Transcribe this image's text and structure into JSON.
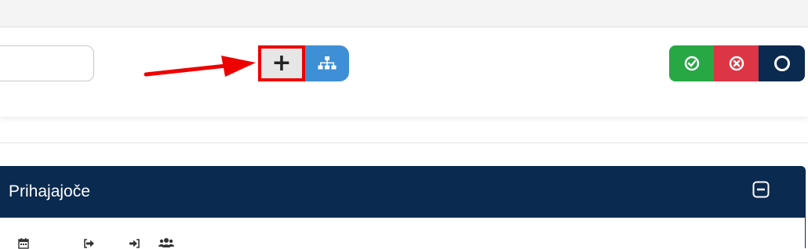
{
  "search": {
    "value": "",
    "placeholder": ""
  },
  "toolbar": {
    "add_button_icon": "plus-icon",
    "hierarchy_button_icon": "sitemap-icon",
    "highlight_color": "#ee0000",
    "annotation": "red-arrow-pointing-to-add-button"
  },
  "actions": {
    "confirm_icon": "check-circle-icon",
    "confirm_color": "#28a745",
    "reject_icon": "times-circle-icon",
    "reject_color": "#dc3545",
    "neutral_icon": "circle-outline-icon",
    "neutral_color": "#0b2a4f"
  },
  "panel": {
    "title": "Prihajajoče",
    "header_color": "#0b2a4f",
    "collapse_icon": "minus-square-icon",
    "columns": [
      {
        "icon": "calendar-icon"
      },
      {
        "icon": "sign-out-icon"
      },
      {
        "icon": "sign-in-icon"
      },
      {
        "icon": "users-icon"
      }
    ]
  }
}
